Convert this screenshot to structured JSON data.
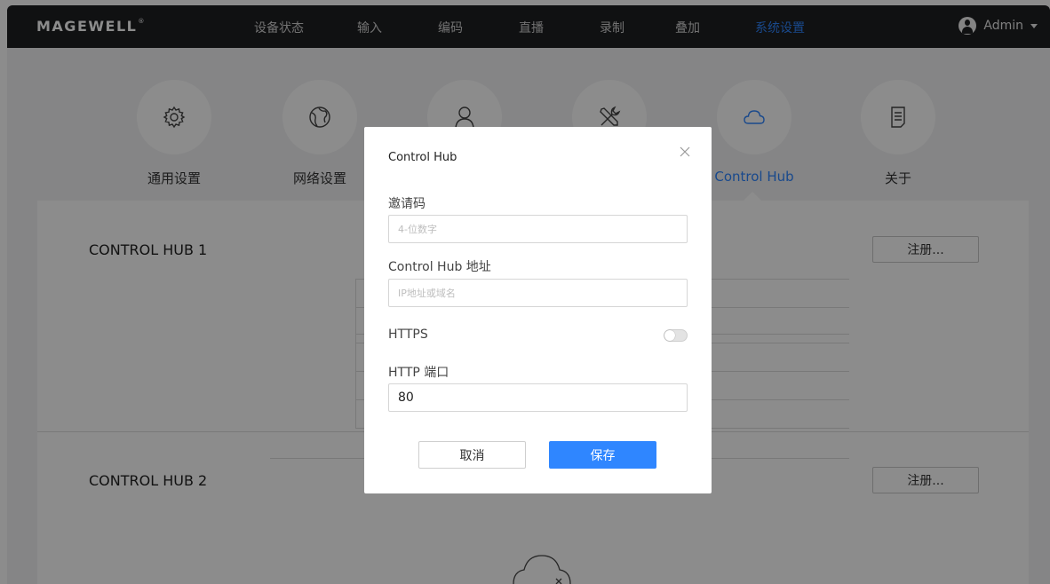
{
  "app": {
    "brand": "MAGEWELL",
    "brand_mark": "®"
  },
  "nav": {
    "items": [
      {
        "label": "设备状态",
        "active": false
      },
      {
        "label": "输入",
        "active": false
      },
      {
        "label": "编码",
        "active": false
      },
      {
        "label": "直播",
        "active": false
      },
      {
        "label": "录制",
        "active": false
      },
      {
        "label": "叠加",
        "active": false
      },
      {
        "label": "系统设置",
        "active": true
      }
    ],
    "user": "Admin"
  },
  "categories": [
    {
      "label": "通用设置",
      "icon": "gear-icon"
    },
    {
      "label": "网络设置",
      "icon": "network-icon"
    },
    {
      "label": "",
      "icon": "user-icon"
    },
    {
      "label": "",
      "icon": "tools-icon"
    },
    {
      "label": "Control Hub",
      "icon": "cloud-icon",
      "active": true
    },
    {
      "label": "关于",
      "icon": "document-icon"
    }
  ],
  "panel": {
    "hub1_title": "CONTROL HUB 1",
    "hub2_title": "CONTROL HUB 2",
    "register_label": "注册..."
  },
  "dialog": {
    "title": "Control Hub",
    "invite_label": "邀请码",
    "invite_placeholder": "4-位数字",
    "address_label": "Control Hub 地址",
    "address_placeholder": "IP地址或域名",
    "https_label": "HTTPS",
    "https_enabled": false,
    "port_label": "HTTP 端口",
    "port_value": "80",
    "cancel_label": "取消",
    "save_label": "保存"
  },
  "colors": {
    "accent": "#2f86ff",
    "topbar": "#1e1f22"
  }
}
